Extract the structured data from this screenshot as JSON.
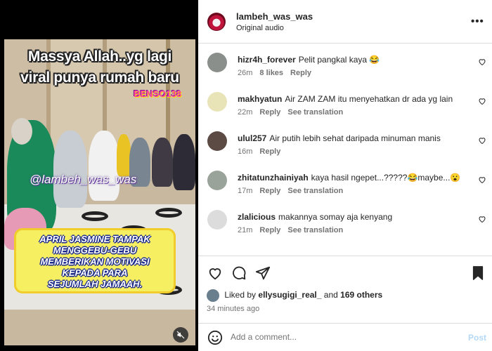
{
  "media": {
    "title_line1": "Massya Allah..yg lagi",
    "title_line2": "viral punya rumah baru",
    "brand": "BENSO138",
    "watermark": "@lambeh_was_was",
    "caption_lines": [
      "APRIL JASMINE TAMPAK",
      "MENGGEBU-GEBU",
      "MEMBERIKAN MOTIVASI",
      "KEPADA PARA",
      "SEJUMLAH JAMAAH."
    ]
  },
  "header": {
    "username": "lambeh_was_was",
    "audio": "Original audio"
  },
  "comments": [
    {
      "user": "hizr4h_forever",
      "text": "Pelit pangkal kaya 😂",
      "time": "26m",
      "likes": "8 likes",
      "reply": "Reply",
      "translate": ""
    },
    {
      "user": "makhyatun",
      "text": "Air ZAM ZAM itu menyehatkan dr ada yg lain",
      "time": "22m",
      "likes": "",
      "reply": "Reply",
      "translate": "See translation"
    },
    {
      "user": "ulul257",
      "text": "Air putih lebih sehat daripada minuman manis",
      "time": "16m",
      "likes": "",
      "reply": "Reply",
      "translate": ""
    },
    {
      "user": "zhitatunzhainiyah",
      "text": "kaya hasil ngepet...?????😂maybe...😮",
      "time": "17m",
      "likes": "",
      "reply": "Reply",
      "translate": "See translation"
    },
    {
      "user": "zlalicious",
      "text": "makannya somay aja kenyang",
      "time": "21m",
      "likes": "",
      "reply": "Reply",
      "translate": "See translation"
    }
  ],
  "likes": {
    "prefix": "Liked by",
    "user": "ellysugigi_real_",
    "and": "and",
    "others": "169 others"
  },
  "timestamp": "34 minutes ago",
  "add_comment": {
    "placeholder": "Add a comment...",
    "post": "Post"
  },
  "colors": {
    "post_disabled": "#b3d9f7",
    "caption_bg": "#f6ef62",
    "caption_outline": "#1b2a8a"
  }
}
